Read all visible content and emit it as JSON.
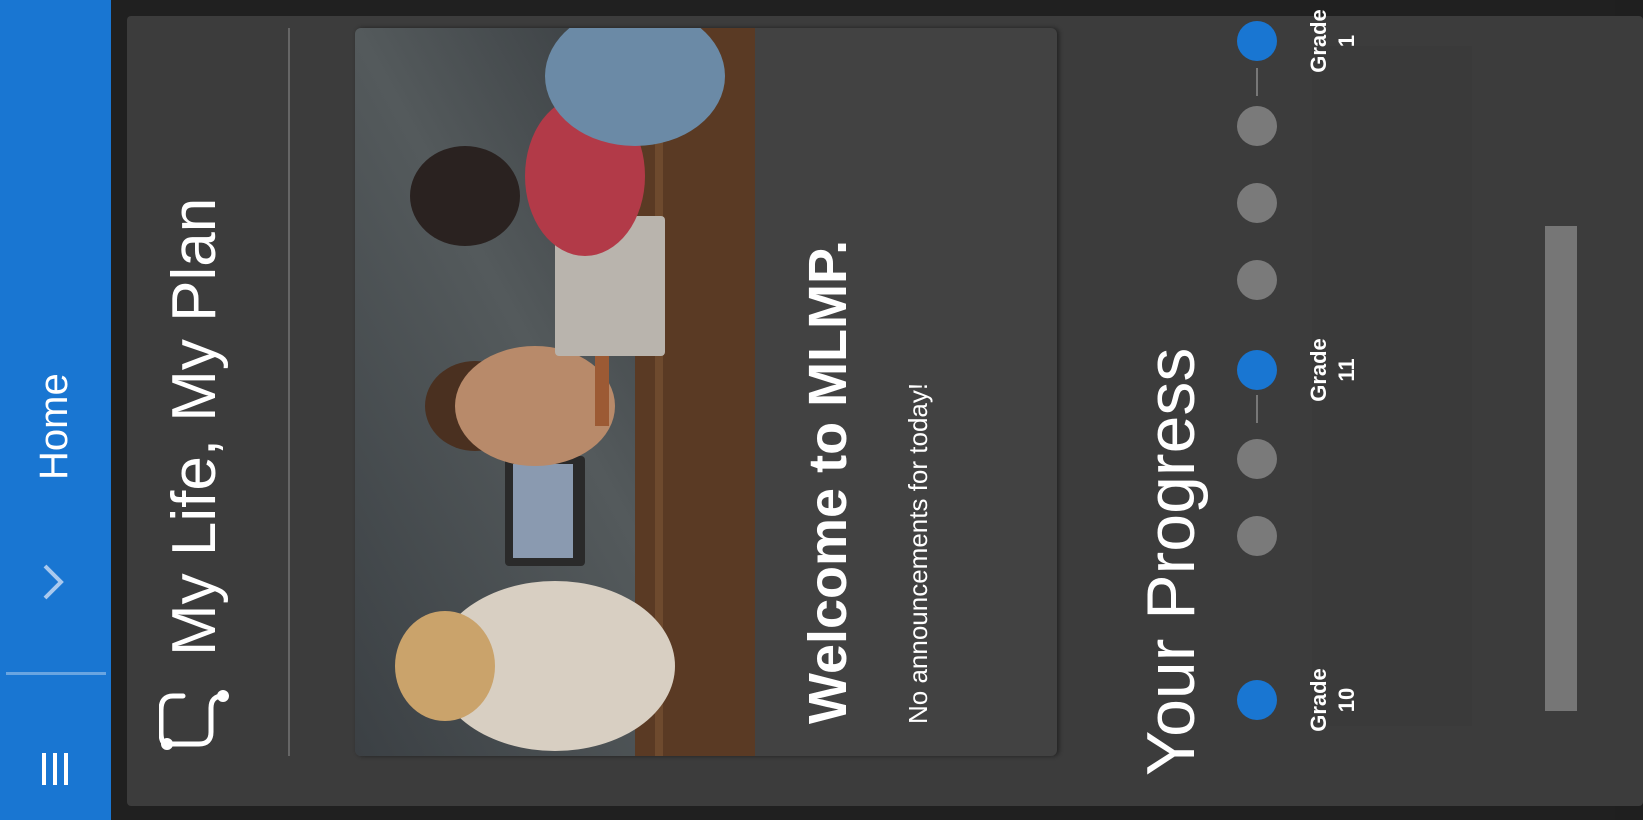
{
  "topbar": {
    "menu_icon": "menu-icon",
    "chevron_icon": "chevron-down-icon",
    "home_label": "Home",
    "color": "#1976d2"
  },
  "brand": {
    "logo_icon": "mlmp-logo-icon",
    "title": "My Life, My Plan"
  },
  "welcome": {
    "title": "Welcome to MLMP.",
    "announcement": "No announcements for today!"
  },
  "progress": {
    "title": "Your Progress",
    "steps": [
      {
        "state": "active",
        "label": "Grade",
        "number": "10"
      },
      {
        "state": "inactive"
      },
      {
        "state": "inactive"
      },
      {
        "state": "active",
        "label": "Grade",
        "number": "11"
      },
      {
        "state": "inactive"
      },
      {
        "state": "inactive"
      },
      {
        "state": "inactive"
      },
      {
        "state": "active",
        "label": "Grade",
        "number": "1"
      }
    ]
  }
}
